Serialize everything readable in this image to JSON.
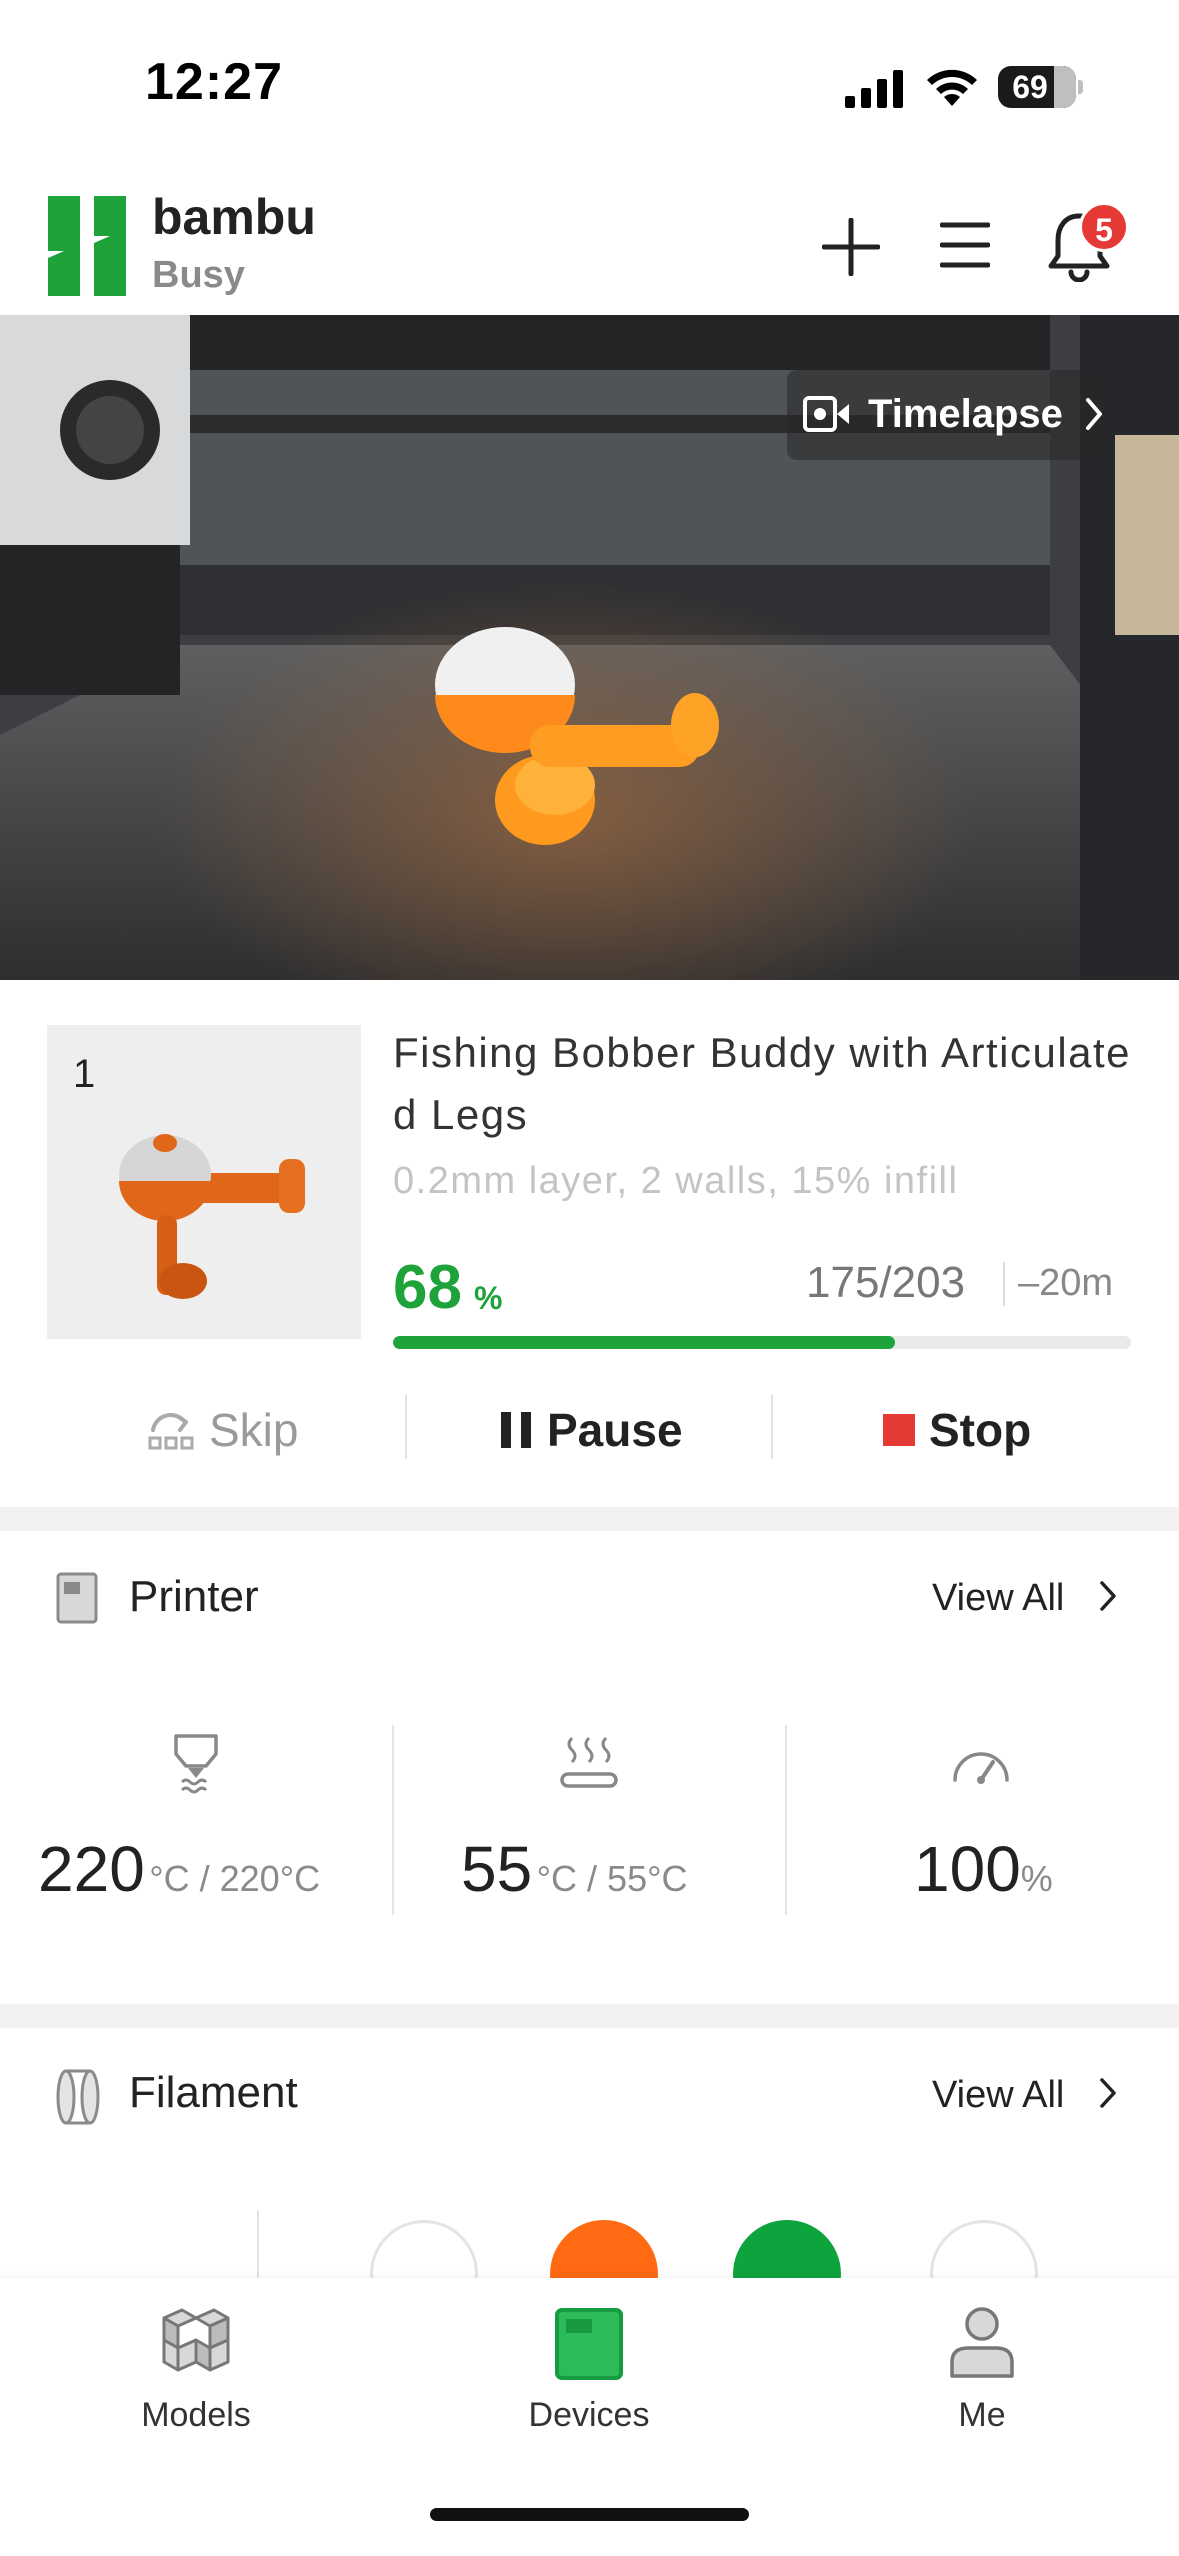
{
  "status_bar": {
    "time": "12:27",
    "battery": "69"
  },
  "header": {
    "brand": "bambu",
    "status": "Busy",
    "notification_count": "5"
  },
  "camera": {
    "timelapse_label": "Timelapse"
  },
  "job": {
    "plate_number": "1",
    "title": "Fishing Bobber Buddy with Articulated Legs",
    "subtitle": "0.2mm layer, 2 walls, 15% infill",
    "progress_percent": "68",
    "progress_fraction": 0.68,
    "percent_sign": "%",
    "layers": "175/203",
    "remaining": "–20m"
  },
  "controls": {
    "skip": "Skip",
    "pause": "Pause",
    "stop": "Stop"
  },
  "printer": {
    "title": "Printer",
    "view_all": "View All",
    "nozzle": {
      "value": "220",
      "unit": "°C / 220°C"
    },
    "bed": {
      "value": "55",
      "unit": "°C / 55°C"
    },
    "speed": {
      "value": "100",
      "unit": "%"
    }
  },
  "filament": {
    "title": "Filament",
    "view_all": "View All",
    "slots": [
      "#ffffff",
      "#ff6a13",
      "#0ea33c",
      "#ffffff"
    ]
  },
  "tabs": [
    {
      "label": "Models"
    },
    {
      "label": "Devices",
      "active": true
    },
    {
      "label": "Me"
    }
  ],
  "colors": {
    "accent": "#1ea33a",
    "stop": "#e53935"
  }
}
